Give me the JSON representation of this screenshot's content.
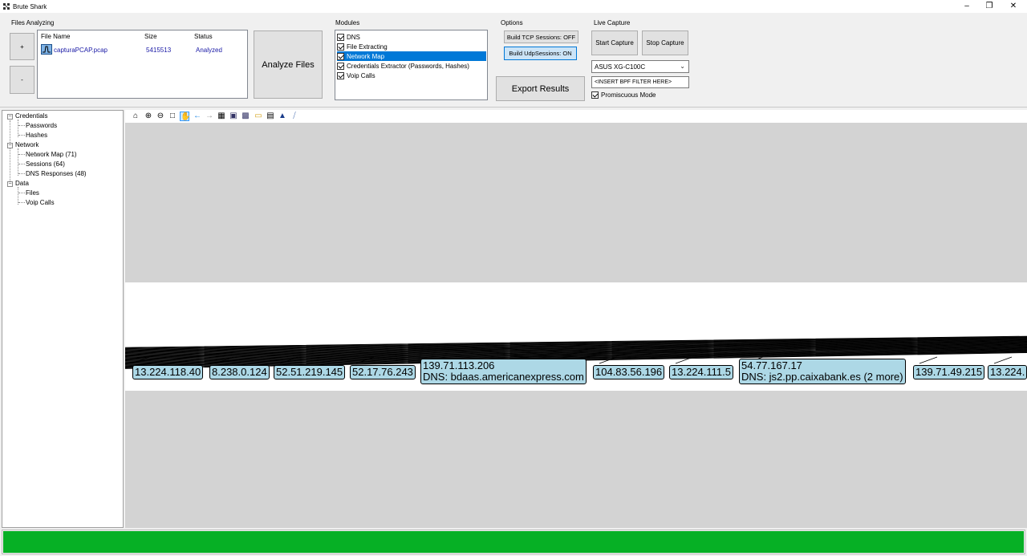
{
  "window": {
    "title": "Brute Shark"
  },
  "files": {
    "group_label": "Files Analyzing",
    "add_label": "+",
    "remove_label": "-",
    "headers": [
      "File Name",
      "Size",
      "Status"
    ],
    "rows": [
      {
        "name": "capturaPCAP.pcap",
        "size": "5415513",
        "status": "Analyzed"
      }
    ],
    "analyze_label": "Analyze Files"
  },
  "modules": {
    "group_label": "Modules",
    "items": [
      {
        "label": "DNS",
        "checked": true,
        "selected": false
      },
      {
        "label": "File Extracting",
        "checked": true,
        "selected": false
      },
      {
        "label": "Network Map",
        "checked": true,
        "selected": true
      },
      {
        "label": "Credentials Extractor (Passwords, Hashes)",
        "checked": true,
        "selected": false
      },
      {
        "label": "Voip Calls",
        "checked": true,
        "selected": false
      }
    ]
  },
  "options": {
    "group_label": "Options",
    "tcp_label": "Build TCP Sessions: OFF",
    "udp_label": "Build UdpSessions: ON",
    "export_label": "Export Results"
  },
  "capture": {
    "group_label": "Live Capture",
    "start_label": "Start Capture",
    "stop_label": "Stop Capture",
    "interface": "ASUS XG-C100C",
    "filter_placeholder": "<INSERT BPF FILTER HERE>",
    "promiscuous_label": "Promiscuous Mode",
    "promiscuous_checked": true
  },
  "tree": {
    "credentials": "Credentials",
    "passwords": "Passwords",
    "hashes": "Hashes",
    "network": "Network",
    "network_map": "Network Map (71)",
    "sessions": "Sessions (64)",
    "dns_responses": "DNS Responses (48)",
    "data": "Data",
    "files": "Files",
    "voip": "Voip Calls",
    "expander": "−"
  },
  "toolbar_icons": [
    "home-icon",
    "zoom-in-icon",
    "zoom-out-icon",
    "window-zoom-icon",
    "pan-hand-icon",
    "back-icon",
    "forward-icon",
    "save-icon",
    "print-preview-icon",
    "layout-icon",
    "open-folder-icon",
    "print-icon",
    "graph-layout-icon",
    "edge-icon"
  ],
  "graph": {
    "nodes": [
      {
        "line1": "13.224.118.40",
        "line2": ""
      },
      {
        "line1": "8.238.0.124",
        "line2": ""
      },
      {
        "line1": "52.51.219.145",
        "line2": ""
      },
      {
        "line1": "52.17.76.243",
        "line2": ""
      },
      {
        "line1": "139.71.113.206",
        "line2": "DNS: bdaas.americanexpress.com"
      },
      {
        "line1": "104.83.56.196",
        "line2": ""
      },
      {
        "line1": "13.224.111.5",
        "line2": ""
      },
      {
        "line1": "54.77.167.17",
        "line2": "DNS: js2.pp.caixabank.es (2 more)"
      },
      {
        "line1": "139.71.49.215",
        "line2": ""
      },
      {
        "line1": "13.224.",
        "line2": ""
      }
    ]
  },
  "progress": {
    "value": 1.0,
    "color": "#06b025"
  }
}
